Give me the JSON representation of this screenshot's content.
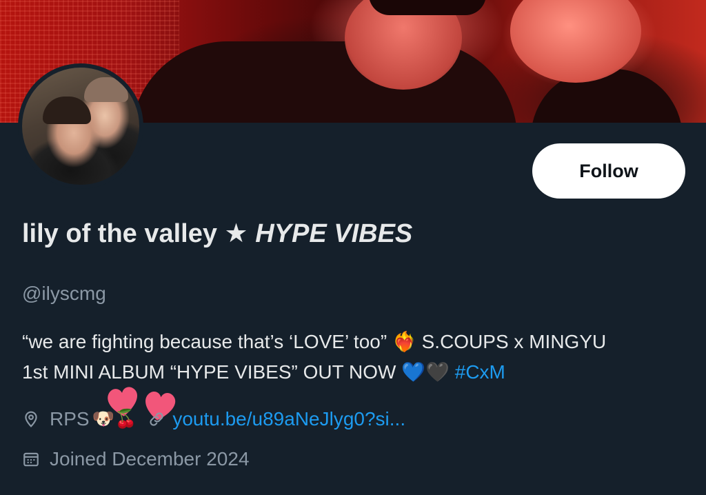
{
  "profile": {
    "display_name_prefix": "lily of the valley ★",
    "display_name_italic": "HYPE VIBES",
    "handle": "@ilyscmg",
    "follow_label": "Follow",
    "bio_line1_text": "“we are fighting because that’s ‘LOVE’ too”",
    "bio_line1_emoji": "❤️‍🔥",
    "bio_line1_rest": "S.COUPS x MINGYU",
    "bio_line2_text": "1st MINI ALBUM “HYPE VIBES” OUT NOW",
    "bio_line2_emoji": "💙🖤",
    "bio_hashtag": "#CxM",
    "location": "RPS",
    "location_emoji": "🐶🍒",
    "link": "youtu.be/u89aNeJlyg0?si...",
    "joined": "Joined December 2024"
  },
  "colors": {
    "background": "#15202b",
    "text": "#e7e9ea",
    "muted": "#8b98a5",
    "accent": "#1d9bf0",
    "heart_sticker": "#f2567a"
  },
  "icons": {
    "location": "location-pin-icon",
    "link": "link-icon",
    "calendar": "calendar-icon",
    "sticker": "hearts-sticker-icon"
  }
}
